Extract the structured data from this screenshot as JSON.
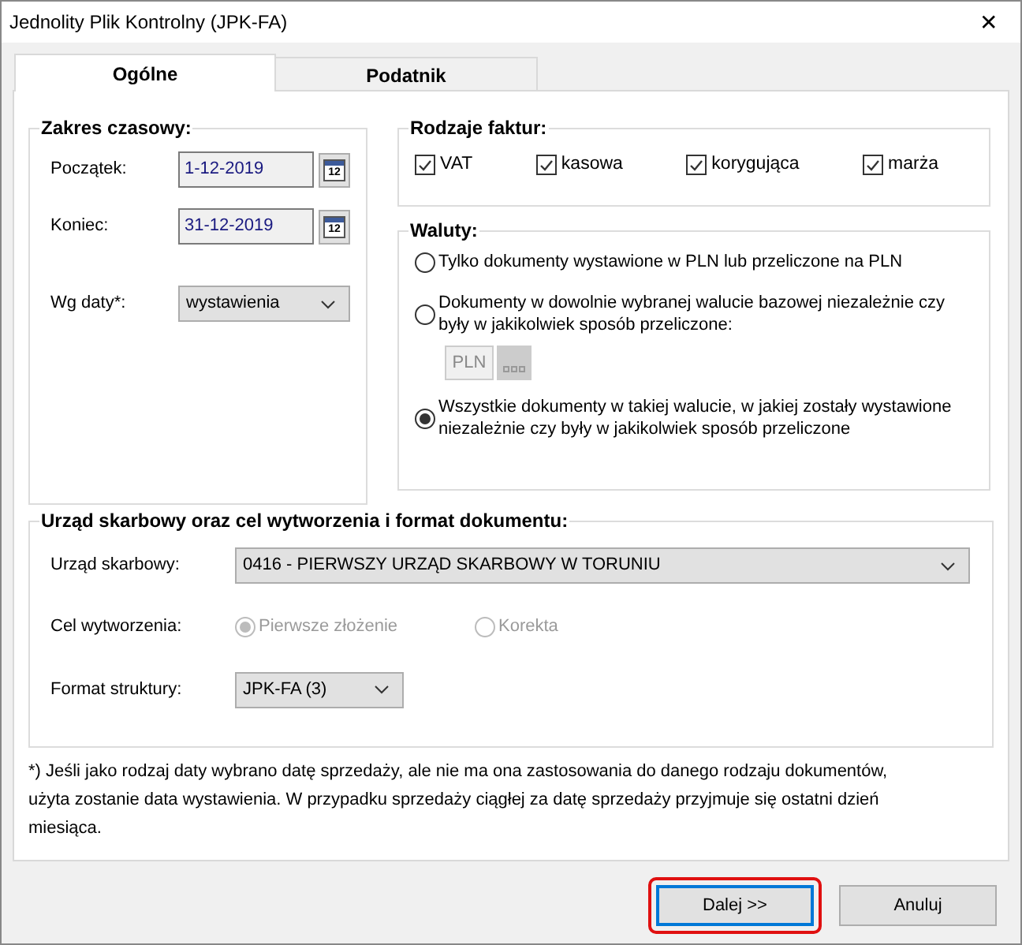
{
  "window": {
    "title": "Jednolity Plik Kontrolny (JPK-FA)",
    "close": "✕"
  },
  "tabs": [
    {
      "label": "Ogólne",
      "selected": true
    },
    {
      "label": "Podatnik",
      "selected": false
    }
  ],
  "date_range": {
    "title": "Zakres czasowy:",
    "fields": [
      {
        "label": "Początek:",
        "value": "1-12-2019",
        "calendar": "12"
      },
      {
        "label": "Koniec:",
        "value": "31-12-2019",
        "calendar": "12"
      }
    ],
    "date_type": {
      "label": "Wg daty*:",
      "value": "wystawienia"
    }
  },
  "invoice_types": {
    "title": "Rodzaje faktur:",
    "items": [
      {
        "label": "VAT",
        "checked": true
      },
      {
        "label": "kasowa",
        "checked": true
      },
      {
        "label": "korygująca",
        "checked": true
      },
      {
        "label": "marża",
        "checked": true
      }
    ]
  },
  "currencies": {
    "title": "Waluty:",
    "options": [
      {
        "label": "Tylko dokumenty wystawione w PLN lub przeliczone na PLN",
        "selected": false
      },
      {
        "label": "Dokumenty w dowolnie wybranej walucie bazowej niezależnie czy były w jakikolwiek sposób przeliczone:",
        "selected": false
      },
      {
        "label": "Wszystkie dokumenty w takiej walucie, w jakiej zostały wystawione niezależnie czy były w jakikolwiek sposób przeliczone",
        "selected": true
      }
    ],
    "currency_code": "PLN"
  },
  "office": {
    "title": "Urząd skarbowy oraz cel wytworzenia i format dokumentu:",
    "tax_office": {
      "label": "Urząd skarbowy:",
      "value": "0416 - PIERWSZY URZĄD SKARBOWY W TORUNIU"
    },
    "purpose": {
      "label": "Cel wytworzenia:",
      "options": [
        {
          "label": "Pierwsze złożenie",
          "selected": true,
          "disabled": true
        },
        {
          "label": "Korekta",
          "selected": false,
          "disabled": true
        }
      ]
    },
    "format": {
      "label": "Format struktury:",
      "value": "JPK-FA (3)"
    }
  },
  "footnote": "*) Jeśli jako rodzaj daty wybrano datę sprzedaży, ale nie ma ona zastosowania do danego rodzaju dokumentów, użyta zostanie data wystawienia. W przypadku sprzedaży ciągłej za datę sprzedaży przyjmuje się ostatni dzień miesiąca.",
  "buttons": [
    {
      "label": "Dalej >>",
      "highlighted": true
    },
    {
      "label": "Anuluj",
      "highlighted": false
    }
  ]
}
